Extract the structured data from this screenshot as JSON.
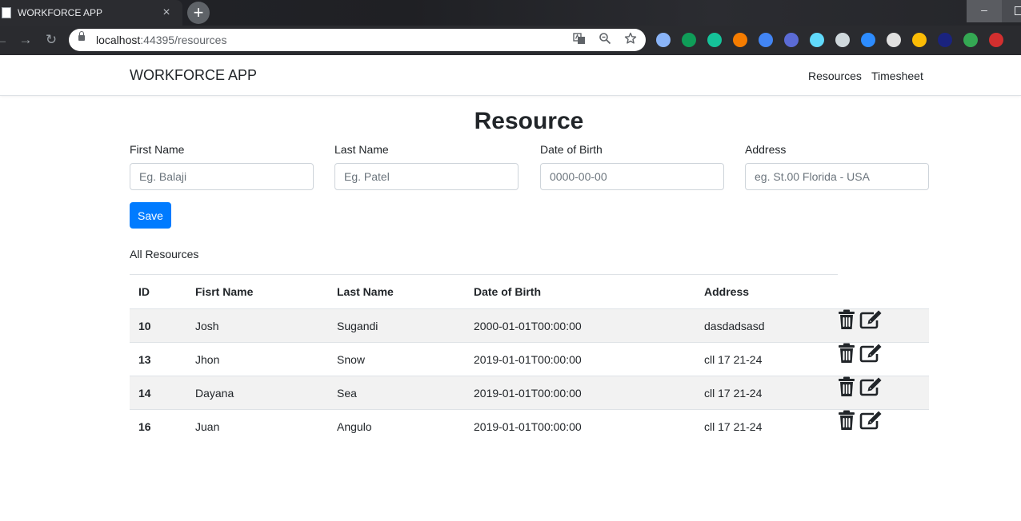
{
  "browser": {
    "tab_title": "WORKFORCE APP",
    "tab_close": "×",
    "new_tab": "+",
    "window_minimize": "–",
    "back": "←",
    "forward": "→",
    "reload": "↻",
    "url_host": "localhost",
    "url_path": ":44395/resources",
    "omnibox_icons": [
      "translate-icon",
      "zoom-icon",
      "bookmark-star-icon"
    ],
    "extension_icons": [
      {
        "name": "extension-1-icon",
        "color": "#8ab4f8"
      },
      {
        "name": "extension-2-icon",
        "color": "#0f9d58"
      },
      {
        "name": "grammarly-icon",
        "color": "#15c39a"
      },
      {
        "name": "extension-4-icon",
        "color": "#f57c00"
      },
      {
        "name": "extension-5-icon",
        "color": "#4285f4"
      },
      {
        "name": "extension-6-icon",
        "color": "#5b6bd5"
      },
      {
        "name": "react-devtools-icon",
        "color": "#61dafb"
      },
      {
        "name": "extension-8-icon",
        "color": "#cfd8dc"
      },
      {
        "name": "zoom-extension-icon",
        "color": "#2d8cff"
      },
      {
        "name": "extension-10-icon",
        "color": "#e0e0e0"
      },
      {
        "name": "chrome-color-icon",
        "color": "#fbbc05"
      },
      {
        "name": "1password-icon",
        "color": "#1a237e"
      },
      {
        "name": "extension-13-icon",
        "color": "#34a853"
      },
      {
        "name": "cors-icon",
        "color": "#d32f2f"
      }
    ]
  },
  "navbar": {
    "brand": "WORKFORCE APP",
    "links": [
      "Resources",
      "Timesheet"
    ]
  },
  "form": {
    "title": "Resource",
    "fields": [
      {
        "label": "First Name",
        "placeholder": "Eg. Balaji",
        "value": ""
      },
      {
        "label": "Last Name",
        "placeholder": "Eg. Patel",
        "value": ""
      },
      {
        "label": "Date of Birth",
        "placeholder": "0000-00-00",
        "value": ""
      },
      {
        "label": "Address",
        "placeholder": "eg. St.00 Florida - USA",
        "value": ""
      }
    ],
    "save_label": "Save"
  },
  "list": {
    "section_label": "All Resources",
    "columns": [
      "ID",
      "Fisrt Name",
      "Last Name",
      "Date of Birth",
      "Address"
    ],
    "rows": [
      {
        "id": "10",
        "first": "Josh",
        "last": "Sugandi",
        "dob": "2000-01-01T00:00:00",
        "address": "dasdadsasd"
      },
      {
        "id": "13",
        "first": "Jhon",
        "last": "Snow",
        "dob": "2019-01-01T00:00:00",
        "address": "cll 17 21-24"
      },
      {
        "id": "14",
        "first": "Dayana",
        "last": "Sea",
        "dob": "2019-01-01T00:00:00",
        "address": "cll 17 21-24"
      },
      {
        "id": "16",
        "first": "Juan",
        "last": "Angulo",
        "dob": "2019-01-01T00:00:00",
        "address": "cll 17 21-24"
      }
    ],
    "row_actions": [
      "trash-icon",
      "edit-icon"
    ]
  },
  "colors": {
    "primary": "#007bff",
    "striped_row": "#f2f2f2",
    "border": "#dee2e6"
  }
}
